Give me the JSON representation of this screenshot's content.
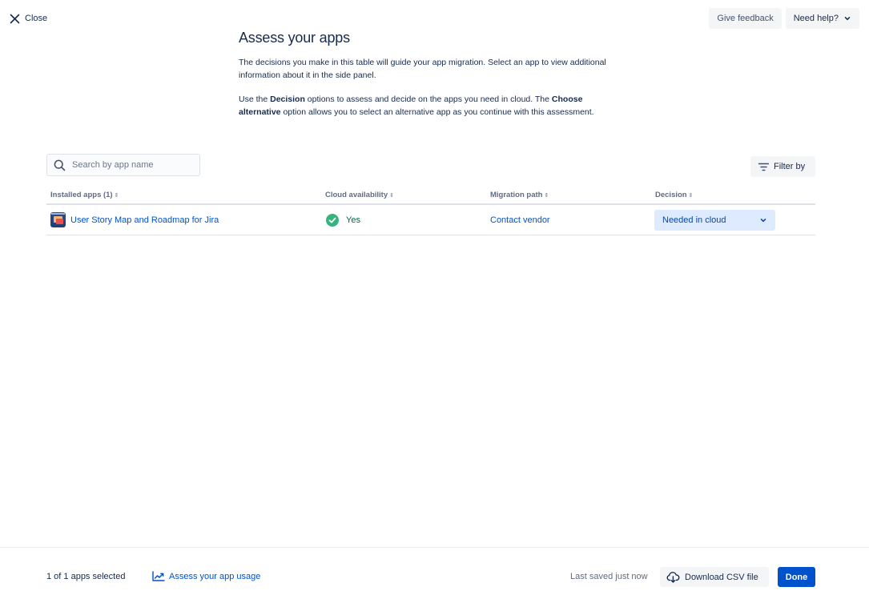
{
  "close": {
    "label": "Close",
    "icon": "close-icon"
  },
  "top_actions": {
    "feedback_label": "Give feedback",
    "help_label": "Need help?"
  },
  "header": {
    "title": "Assess your apps",
    "para1": "The decisions you make in this table will guide your app migration. Select an app to view additional information about it in the side panel.",
    "para2_a": "Use the ",
    "para2_b": "Decision",
    "para2_c": " options to assess and decide on the apps you need in cloud. The ",
    "para2_d": "Choose alternative",
    "para2_e": " option allows you to select an alternative app as you continue with this assessment."
  },
  "search": {
    "placeholder": "Search by app name",
    "value": ""
  },
  "filter": {
    "label": "Filter by"
  },
  "table": {
    "columns": [
      "Installed apps (1)",
      "Cloud availability",
      "Migration path",
      "Decision"
    ],
    "rows": [
      {
        "app_name": "User Story Map and Roadmap for Jira",
        "cloud_availability": "Yes",
        "migration_path": "Contact vendor",
        "decision": "Needed in cloud"
      }
    ]
  },
  "footer": {
    "selected": "1 of 1 apps selected",
    "usage_link": "Assess your app usage",
    "saved": "Last saved just now",
    "csv_label": "Download CSV file",
    "done_label": "Done"
  },
  "colors": {
    "brand": "#0052CC",
    "success": "#36B37E",
    "selection_bg": "#DEEBFF"
  }
}
